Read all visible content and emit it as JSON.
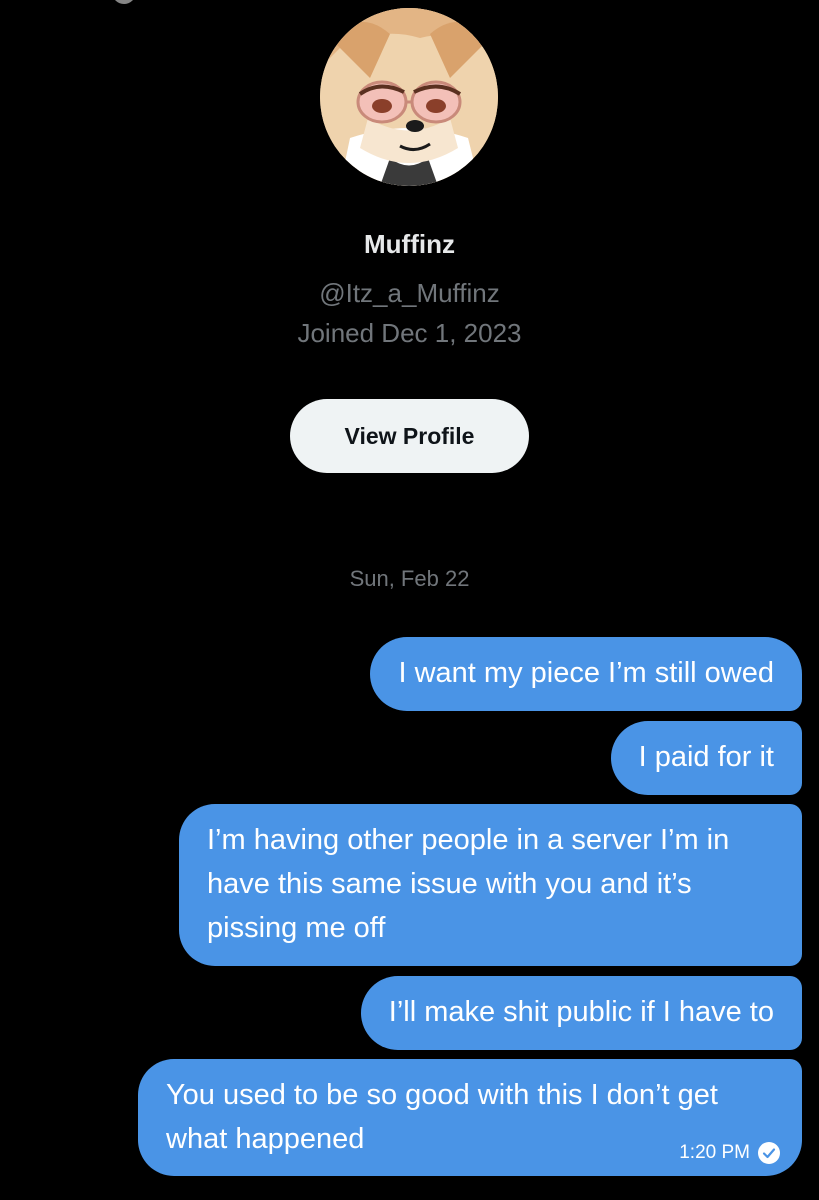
{
  "profile": {
    "display_name": "Muffinz",
    "handle": "@Itz_a_Muffinz",
    "joined": "Joined Dec 1, 2023",
    "view_profile_label": "View Profile"
  },
  "conversation": {
    "date_separator": "Sun, Feb 22",
    "messages": [
      {
        "text": "I want my piece I’m still owed"
      },
      {
        "text": "I paid for it"
      },
      {
        "text": "I’m having other people in a server I’m in have this same issue with you and it’s pissing me off"
      },
      {
        "text": "I’ll make shit public if I have to"
      },
      {
        "text": "You used to be so good with this I don’t get what happened",
        "time": "1:20 PM",
        "status_icon": "read-check-icon"
      }
    ]
  },
  "colors": {
    "background": "#000000",
    "sent_bubble": "#4a94e6",
    "button_bg": "#eff3f4",
    "muted_text": "#71767b"
  }
}
